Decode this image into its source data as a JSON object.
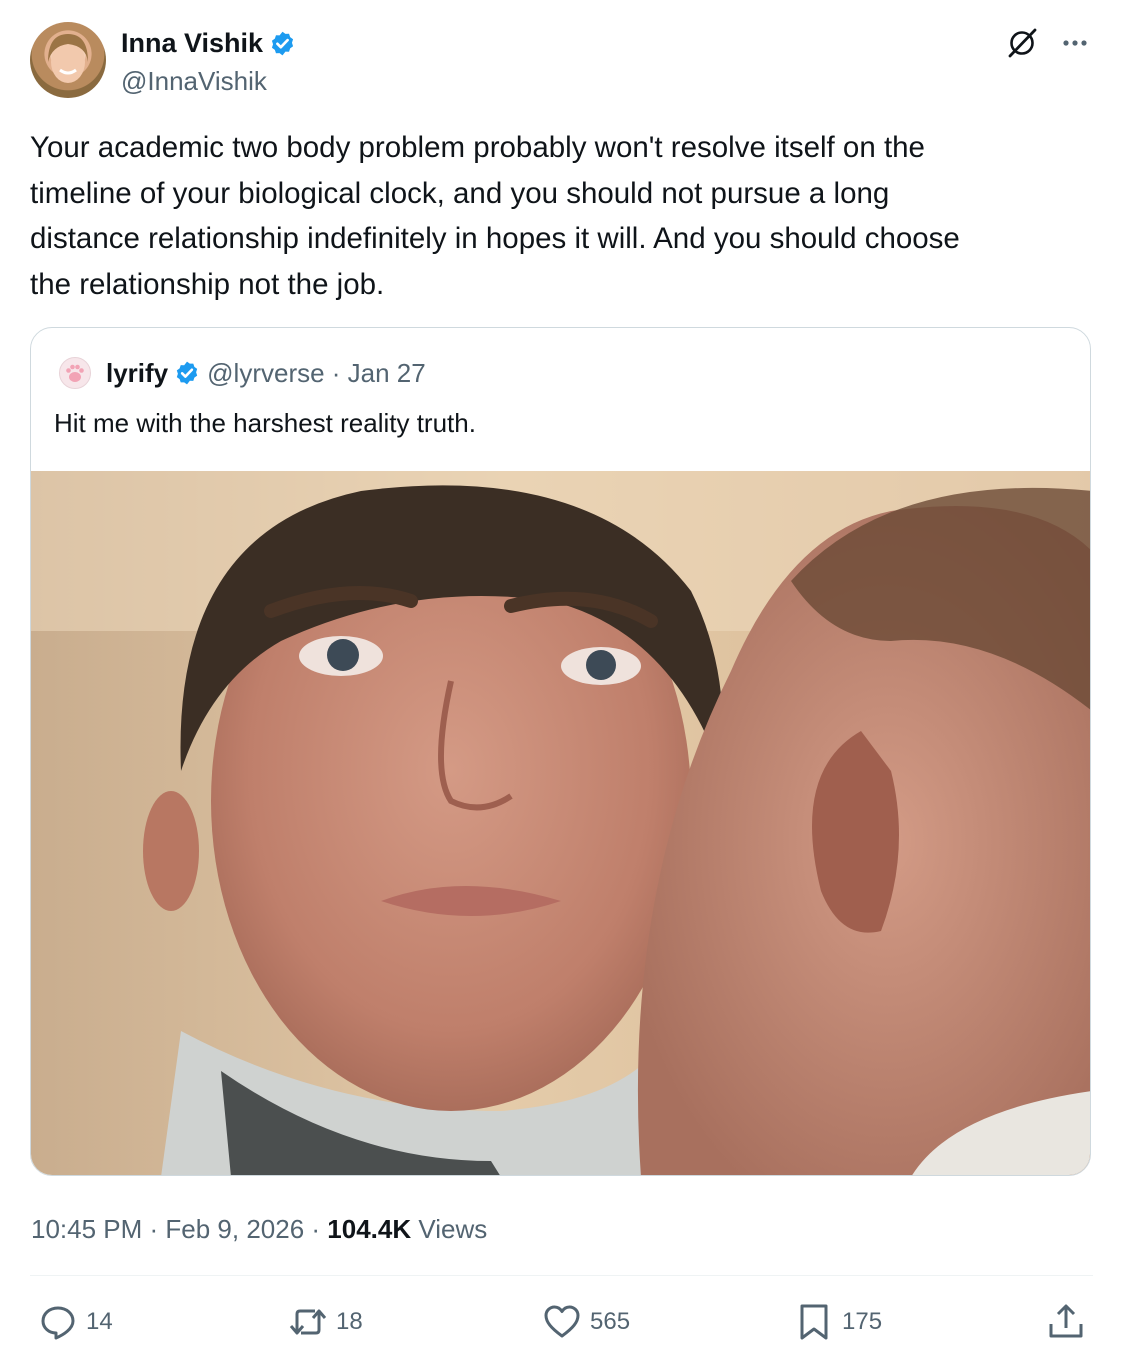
{
  "tweet": {
    "author": {
      "name": "Inna Vishik",
      "handle": "@InnaVishik"
    },
    "text": "Your academic two body problem probably won't resolve itself on the\ntimeline of your biological clock, and you should not pursue a long\ndistance relationship indefinitely in hopes it will.  And you should choose\nthe relationship not the job.",
    "quoted": {
      "author_name": "lyrify",
      "meta": "@lyrverse · Jan 27",
      "text": "Hit me with the harshest reality truth."
    },
    "time": "10:45 PM · Feb 9, 2026 · ",
    "views_count": "104.4K",
    "views_label": " Views",
    "actions": {
      "reply": {
        "icon": "reply-icon",
        "count": "14"
      },
      "repost": {
        "icon": "repost-icon",
        "count": "18"
      },
      "like": {
        "icon": "heart-icon",
        "count": "565"
      },
      "bookmark": {
        "icon": "bookmark-icon",
        "count": "175"
      },
      "share": {
        "icon": "share-icon"
      }
    }
  },
  "colors": {
    "verified": "#1d9bf0",
    "secondary_text": "#536471",
    "primary_text": "#0f1419",
    "border": "#cfd9de"
  }
}
